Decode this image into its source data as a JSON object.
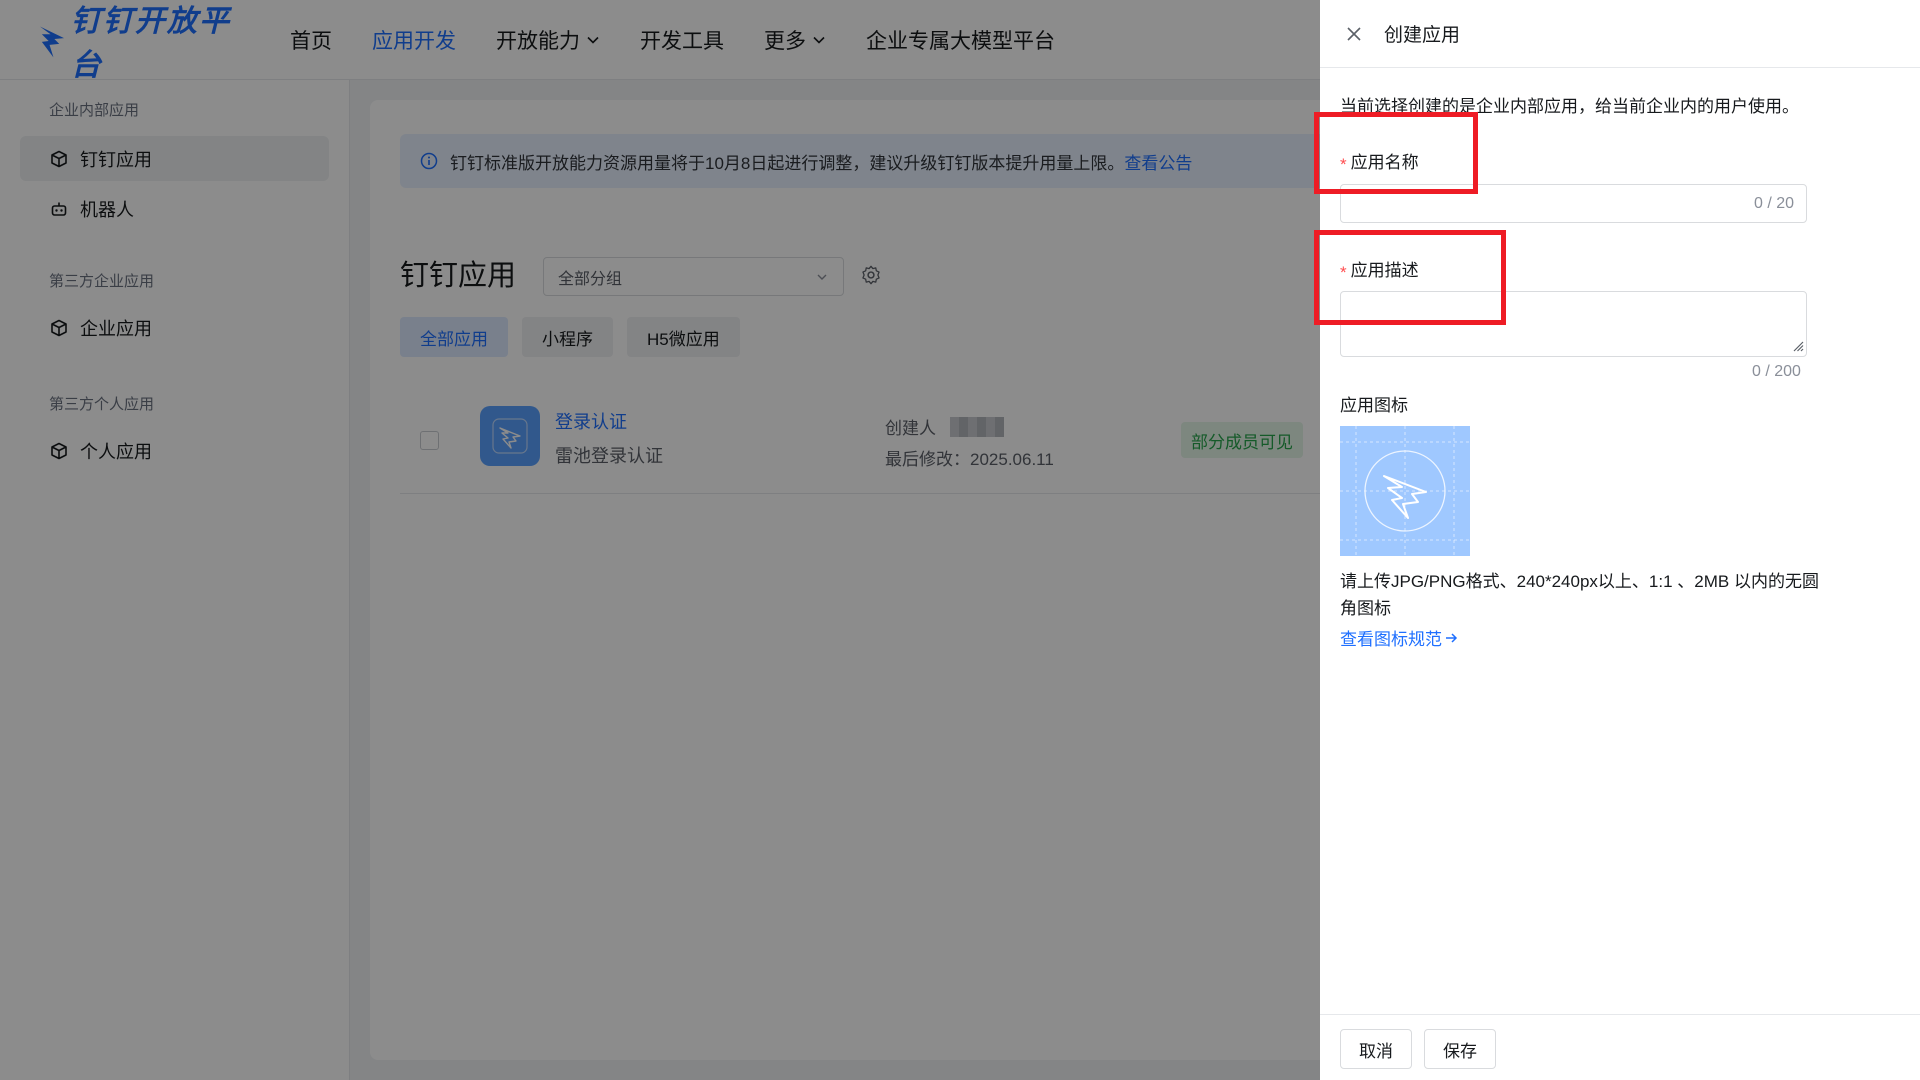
{
  "brand": {
    "name": "钉钉开放平台"
  },
  "topnav": {
    "items": [
      {
        "label": "首页",
        "active": false,
        "dropdown": false
      },
      {
        "label": "应用开发",
        "active": true,
        "dropdown": false
      },
      {
        "label": "开放能力",
        "active": false,
        "dropdown": true
      },
      {
        "label": "开发工具",
        "active": false,
        "dropdown": false
      },
      {
        "label": "更多",
        "active": false,
        "dropdown": true
      },
      {
        "label": "企业专属大模型平台",
        "active": false,
        "dropdown": false
      }
    ]
  },
  "sidebar": {
    "groups": [
      {
        "title": "企业内部应用",
        "items": [
          {
            "label": "钉钉应用",
            "icon": "cube-icon",
            "active": true
          },
          {
            "label": "机器人",
            "icon": "robot-icon",
            "active": false
          }
        ]
      },
      {
        "title": "第三方企业应用",
        "items": [
          {
            "label": "企业应用",
            "icon": "cube-icon",
            "active": false
          }
        ]
      },
      {
        "title": "第三方个人应用",
        "items": [
          {
            "label": "个人应用",
            "icon": "cube-icon",
            "active": false
          }
        ]
      }
    ]
  },
  "main": {
    "notice": {
      "text": "钉钉标准版开放能力资源用量将于10月8日起进行调整，建议升级钉钉版本提升用量上限。",
      "link": "查看公告"
    },
    "title": "钉钉应用",
    "group_select": {
      "value": "全部分组"
    },
    "tabs": [
      {
        "label": "全部应用",
        "active": true
      },
      {
        "label": "小程序",
        "active": false
      },
      {
        "label": "H5微应用",
        "active": false
      }
    ],
    "apps": [
      {
        "name": "登录认证",
        "desc": "雷池登录认证",
        "creator_label": "创建人",
        "modified": "最后修改：2025.06.11",
        "status": "部分成员可见"
      }
    ]
  },
  "drawer": {
    "title": "创建应用",
    "tip": "当前选择创建的是企业内部应用，给当前企业内的用户使用。",
    "required_mark": "*",
    "name_field": {
      "label": "应用名称",
      "value": "",
      "count": "0 / 20"
    },
    "desc_field": {
      "label": "应用描述",
      "value": "",
      "count": "0 / 200"
    },
    "icon_field": {
      "label": "应用图标",
      "hint": "请上传JPG/PNG格式、240*240px以上、1:1 、2MB 以内的无圆角图标",
      "link": "查看图标规范"
    },
    "buttons": {
      "cancel": "取消",
      "save": "保存"
    }
  },
  "colors": {
    "accent": "#1e6fff",
    "annotation": "#ee1c25",
    "status_green": "#27a54b"
  }
}
